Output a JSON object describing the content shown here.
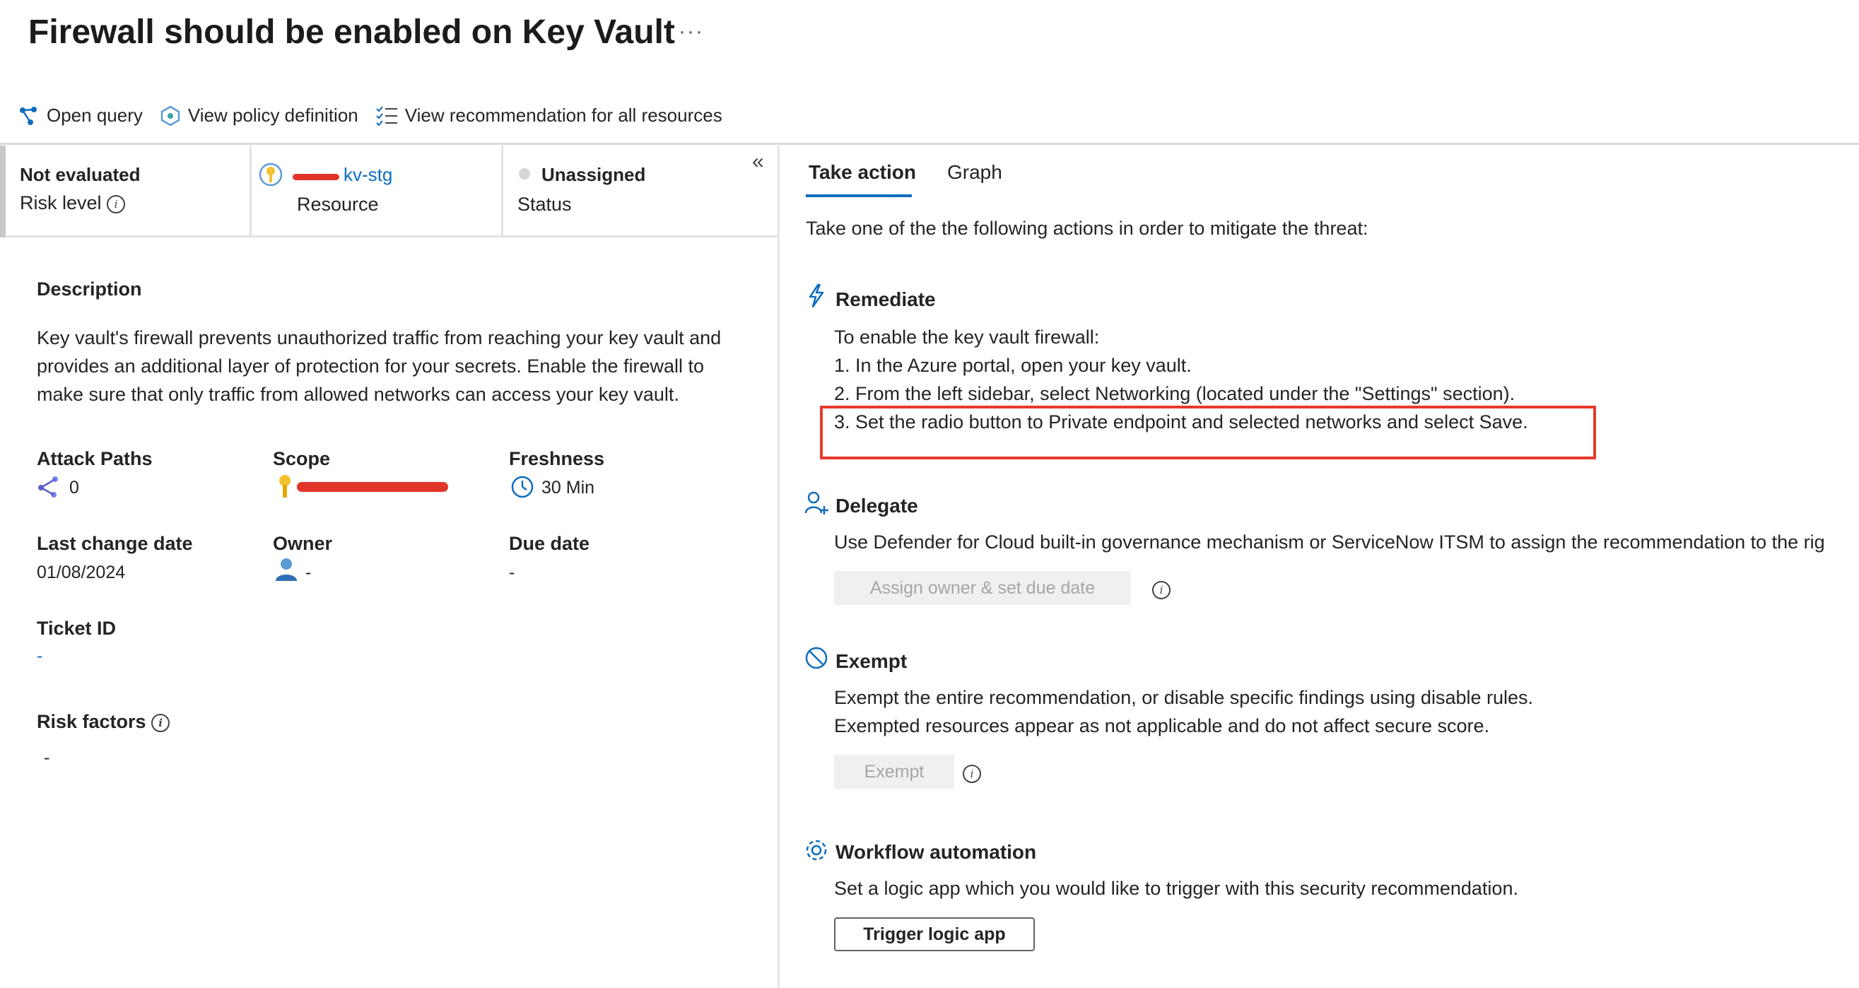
{
  "header": {
    "title": "Firewall should be enabled on Key Vault",
    "more": "···"
  },
  "toolbar": {
    "open_query": "Open query",
    "view_policy": "View policy definition",
    "view_all": "View recommendation for all resources"
  },
  "summary": {
    "risk": {
      "value": "Not evaluated",
      "label": "Risk level"
    },
    "resource": {
      "name": "kv-stg",
      "label": "Resource"
    },
    "status": {
      "value": "Unassigned",
      "label": "Status"
    },
    "collapse": "«"
  },
  "details": {
    "description_title": "Description",
    "description_lines": [
      "Key vault's firewall prevents unauthorized traffic from reaching your key vault and",
      "provides an additional layer of protection for your secrets. Enable the firewall to",
      "make sure that only traffic from allowed networks can access your key vault."
    ],
    "attack_paths": {
      "label": "Attack Paths",
      "value": "0"
    },
    "scope": {
      "label": "Scope"
    },
    "freshness": {
      "label": "Freshness",
      "value": "30 Min"
    },
    "last_change": {
      "label": "Last change date",
      "value": "01/08/2024"
    },
    "owner": {
      "label": "Owner",
      "value": "-"
    },
    "due_date": {
      "label": "Due date",
      "value": "-"
    },
    "ticket_id": {
      "label": "Ticket ID",
      "value": "-"
    },
    "risk_factors": {
      "label": "Risk factors",
      "value": "-"
    }
  },
  "tabs": {
    "take_action": "Take action",
    "graph": "Graph"
  },
  "action": {
    "intro": "Take one of the the following actions in order to mitigate the threat:",
    "remediate": {
      "title": "Remediate",
      "lines": [
        "To enable the key vault firewall:",
        "1. In the Azure portal, open your key vault.",
        "2. From the left sidebar, select Networking (located under the \"Settings\" section).",
        "3. Set the radio button to Private endpoint and selected networks and select Save."
      ]
    },
    "delegate": {
      "title": "Delegate",
      "text": "Use Defender for Cloud built-in governance mechanism or ServiceNow ITSM to assign the recommendation to the rig",
      "button": "Assign owner & set due date"
    },
    "exempt": {
      "title": "Exempt",
      "line1": "Exempt the entire recommendation, or disable specific findings using disable rules.",
      "line2": "Exempted resources appear as not applicable and do not affect secure score.",
      "button": "Exempt"
    },
    "workflow": {
      "title": "Workflow automation",
      "text": "Set a logic app which you would like to trigger with this security recommendation.",
      "button": "Trigger logic app"
    }
  },
  "colors": {
    "accent": "#0f6cbd",
    "highlight": "#e8392b",
    "redaction": "#e2352a"
  }
}
